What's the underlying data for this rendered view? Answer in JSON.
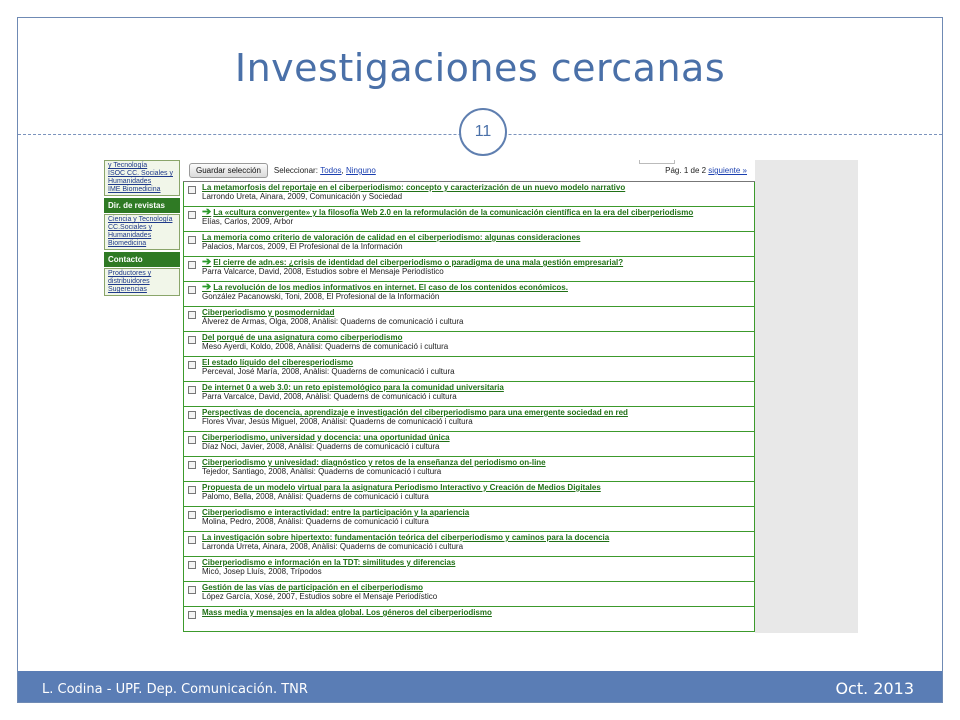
{
  "slide": {
    "title": "Investigaciones cercanas",
    "page_number": "11",
    "footer_left": "L. Codina - UPF. Dep. Comunicación. TNR",
    "footer_right": "Oct. 2013",
    "colors": {
      "title": "#4a70a8",
      "footer": "#5a7db5",
      "link_green": "#207016",
      "sidebar_green": "#2f7a24"
    }
  },
  "sidebar": {
    "top_box": [
      "y Tecnología",
      "ISOC CC. Sociales y Humanidades",
      "IME Biomedicina"
    ],
    "revistas_label": "Dir. de revistas",
    "revistas_items": [
      "Ciencia y Tecnología",
      "CC.Sociales y Humanidades",
      "Biomedicina"
    ],
    "contacto_label": "Contacto",
    "contacto_items": [
      "Productores y distribuidores",
      "Sugerencias"
    ]
  },
  "toolbar": {
    "save_label": "Guardar selección",
    "select_label": "Seleccionar:",
    "all_label": "Todos",
    "none_label": "Ninguno",
    "page_info": "Pág. 1 de 2",
    "next_label": "siguiente »"
  },
  "records": [
    {
      "title": "La metamorfosis del reportaje en el ciberperiodismo: concepto y caracterización de un nuevo modelo narrativo",
      "meta": "Larrondo Ureta, Ainara, 2009, Comunicación y Sociedad",
      "arrow": false
    },
    {
      "title": "La «cultura convergente» y la filosofía Web 2.0 en la reformulación de la comunicación científica en la era del ciberperiodismo",
      "meta": "Elías, Carlos, 2009, Arbor",
      "arrow": true
    },
    {
      "title": "La memoria como criterio de valoración de calidad en el ciberperiodismo: algunas consideraciones",
      "meta": "Palacios, Marcos, 2009, El Profesional de la Información",
      "arrow": false
    },
    {
      "title": "El cierre de adn.es: ¿crisis de identidad del ciberperiodismo o paradigma de una mala gestión empresarial?",
      "meta": "Parra Valcarce, David, 2008, Estudios sobre el Mensaje Periodístico",
      "arrow": true
    },
    {
      "title": "La revolución de los medios informativos en internet. El caso de los contenidos económicos.",
      "meta": "González Pacanowski, Toni, 2008, El Profesional de la Información",
      "arrow": true
    },
    {
      "title": "Ciberperiodismo y posmodernidad",
      "meta": "Álverez de Armas, Olga, 2008, Anàlisi: Quaderns de comunicació i cultura",
      "arrow": false
    },
    {
      "title": "Del porqué de una asignatura como ciberperiodismo",
      "meta": "Meso Ayerdi, Koldo, 2008, Anàlisi: Quaderns de comunicació i cultura",
      "arrow": false
    },
    {
      "title": "El estado líquido del ciberesperiodismo",
      "meta": "Perceval, José María, 2008, Anàlisi: Quaderns de comunicació i cultura",
      "arrow": false
    },
    {
      "title": "De internet 0 a web 3.0: un reto epistemológico para la comunidad universitaria",
      "meta": "Parra Varcalce, David, 2008, Anàlisi: Quaderns de comunicació i cultura",
      "arrow": false
    },
    {
      "title": "Perspectivas de docencia, aprendizaje e investigación del ciberperiodismo para una emergente sociedad en red",
      "meta": "Flores Vivar, Jesús Miguel, 2008, Anàlisi: Quaderns de comunicació i cultura",
      "arrow": false
    },
    {
      "title": "Ciberperiodismo, universidad y docencia: una oportunidad única",
      "meta": "Díaz Noci, Javier, 2008, Anàlisi: Quaderns de comunicació i cultura",
      "arrow": false
    },
    {
      "title": "Ciberperiodismo y univesidad: diagnóstico y retos de la enseñanza del periodismo on-line",
      "meta": "Tejedor, Santiago, 2008, Anàlisi: Quaderns de comunicació i cultura",
      "arrow": false
    },
    {
      "title": "Propuesta de un modelo virtual para la asignatura Periodismo Interactivo y Creación de Medios Digitales",
      "meta": "Palomo, Bella, 2008, Anàlisi: Quaderns de comunicació i cultura",
      "arrow": false
    },
    {
      "title": "Ciberperiodismo e interactividad: entre la participación y la apariencia",
      "meta": "Molina, Pedro, 2008, Anàlisi: Quaderns de comunicació i cultura",
      "arrow": false
    },
    {
      "title": "La investigación sobre hipertexto: fundamentación teórica del ciberperiodismo y caminos para la docencia",
      "meta": "Larronda Urreta, Ainara, 2008, Anàlisi: Quaderns de comunicació i cultura",
      "arrow": false
    },
    {
      "title": "Ciberperiodismo e información en la TDT: similitudes y diferencias",
      "meta": "Micó, Josep Lluís, 2008, Trípodos",
      "arrow": false
    },
    {
      "title": "Gestión de las vías de participación en el ciberperiodismo",
      "meta": "López García, Xosé, 2007, Estudios sobre el Mensaje Periodístico",
      "arrow": false
    },
    {
      "title": "Mass media y mensajes en la aldea global. Los géneros del ciberperiodismo",
      "meta": "",
      "arrow": false
    }
  ]
}
